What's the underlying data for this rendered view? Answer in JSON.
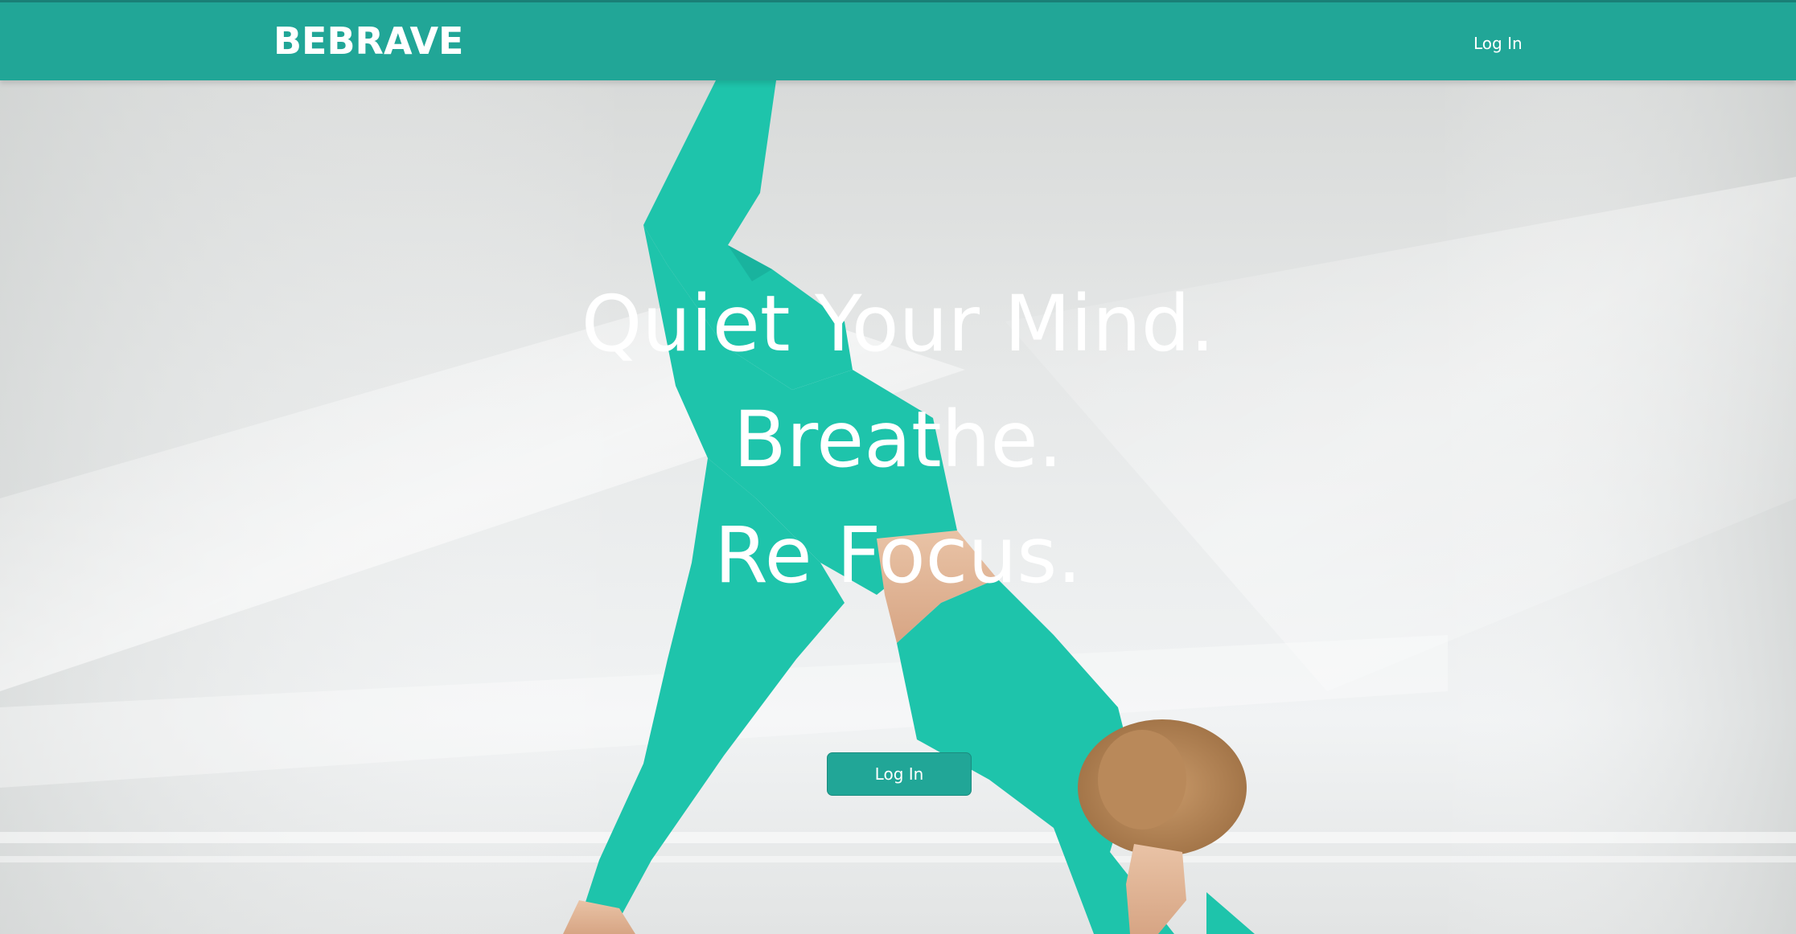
{
  "header": {
    "brand": "BEBRAVE",
    "login_label": "Log In"
  },
  "hero": {
    "line1": "Quiet Your Mind.",
    "line2": "Breathe.",
    "line3": "Re Focus.",
    "cta_label": "Log In"
  },
  "colors": {
    "primary": "#21a697",
    "outfit": "#1ec4ab",
    "text": "#ffffff"
  }
}
